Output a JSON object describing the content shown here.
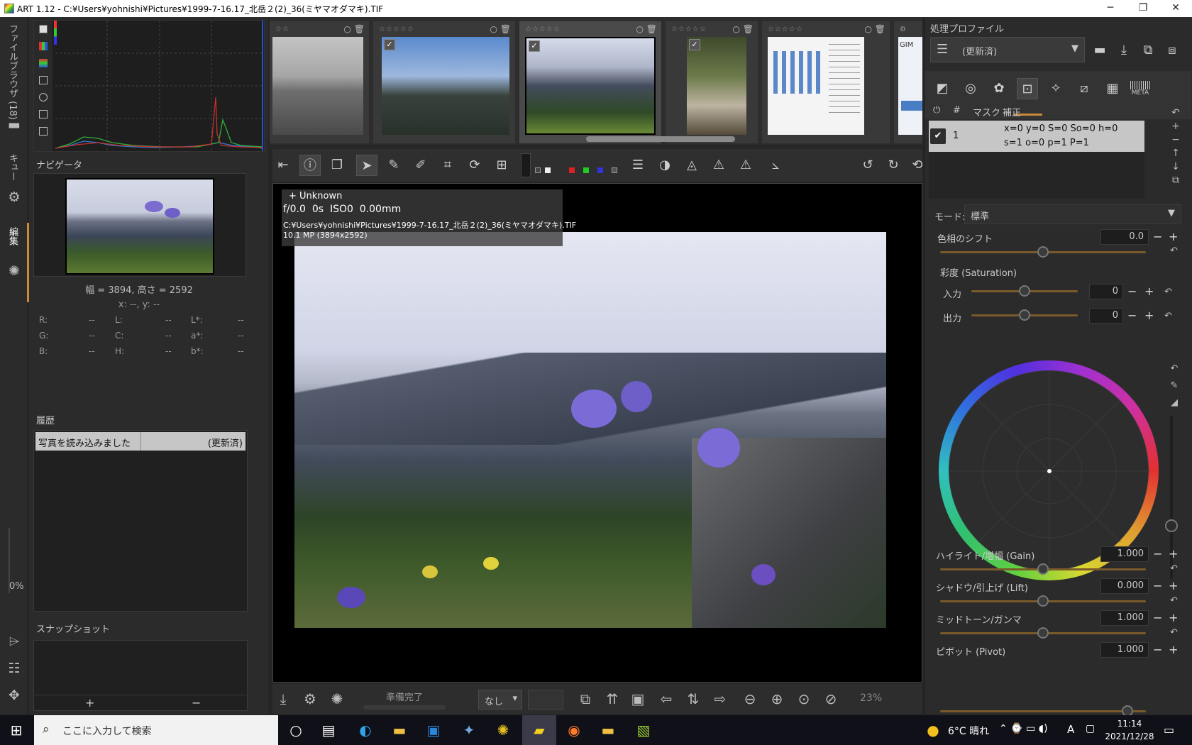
{
  "window": {
    "title": "ART 1.12 - C:¥Users¥yohnishi¥Pictures¥1999-7-16.17_北岳２(2)_36(ミヤマオダマキ).TIF",
    "minimize": "─",
    "maximize": "❐",
    "close": "✕"
  },
  "left_strip": {
    "file_browser_label": "ファイルブラウザ (18)",
    "queue_label": "キュー",
    "edit_label": "編集",
    "zoom_percent": "0%"
  },
  "navigator": {
    "title": "ナビゲータ",
    "dimensions": "幅 = 3894, 高さ = 2592",
    "xy": "x: --, y: --",
    "values": [
      {
        "label": "R:",
        "value": "--"
      },
      {
        "label": "G:",
        "value": "--"
      },
      {
        "label": "B:",
        "value": "--"
      },
      {
        "label": "L:",
        "value": "--"
      },
      {
        "label": "C:",
        "value": "--"
      },
      {
        "label": "H:",
        "value": "--"
      },
      {
        "label": "L*:",
        "value": "--"
      },
      {
        "label": "a*:",
        "value": "--"
      },
      {
        "label": "b*:",
        "value": "--"
      }
    ]
  },
  "history": {
    "title": "履歴",
    "rows": [
      {
        "action": "写真を読み込みました",
        "state": "(更新済)"
      }
    ]
  },
  "snapshot": {
    "title": "スナップショット",
    "add": "+",
    "remove": "−"
  },
  "filmstrip": {
    "stars": "☆☆☆☆☆",
    "stars_short": "☆☆",
    "thumb_label_last": "GIM"
  },
  "viewer": {
    "camera": "+ Unknown",
    "aperture": "f/0.0",
    "shutter": "0s",
    "iso": "ISO0",
    "ev": "0.00mm",
    "path": "C:¥Users¥yohnishi¥Pictures¥1999-7-16.17_北岳２(2)_36(ミヤマオダマキ).TIF",
    "size": "10.1 MP (3894x2592)"
  },
  "bottom_bar": {
    "status": "準備完了",
    "select_value": "なし",
    "zoom": "23%"
  },
  "right_panel": {
    "profile_title": "処理プロファイル",
    "profile_value": "(更新済)",
    "meta_tab": "META",
    "table_headers": [
      "#",
      "マスク",
      "補正"
    ],
    "table_row": {
      "num": "1",
      "line1": "x=0 y=0 S=0 So=0 h=0",
      "line2": "s=1 o=0 p=1 P=1"
    },
    "mode_label": "モード:",
    "mode_value": "標準",
    "hue_shift": {
      "label": "色相のシフト",
      "value": "0.0",
      "level": 0.5
    },
    "saturation_title": "彩度 (Saturation)",
    "sat_input": {
      "label": "入力",
      "value": "0",
      "level": 0.5
    },
    "sat_output": {
      "label": "出力",
      "value": "0",
      "level": 0.5
    },
    "gain": {
      "label": "ハイライト/増幅 (Gain)",
      "value": "1.000",
      "level": 0.5
    },
    "lift": {
      "label": "シャドウ/引上げ (Lift)",
      "value": "0.000",
      "level": 0.5
    },
    "gamma": {
      "label": "ミッドトーン/ガンマ",
      "value": "1.000",
      "level": 0.5
    },
    "pivot": {
      "label": "ピボット (Pivot)",
      "value": "1.000",
      "level": 0.91
    }
  },
  "taskbar": {
    "search_placeholder": "ここに入力して検索",
    "weather": "6°C 晴れ",
    "ime": "A",
    "time": "11:14",
    "date": "2021/12/28"
  }
}
